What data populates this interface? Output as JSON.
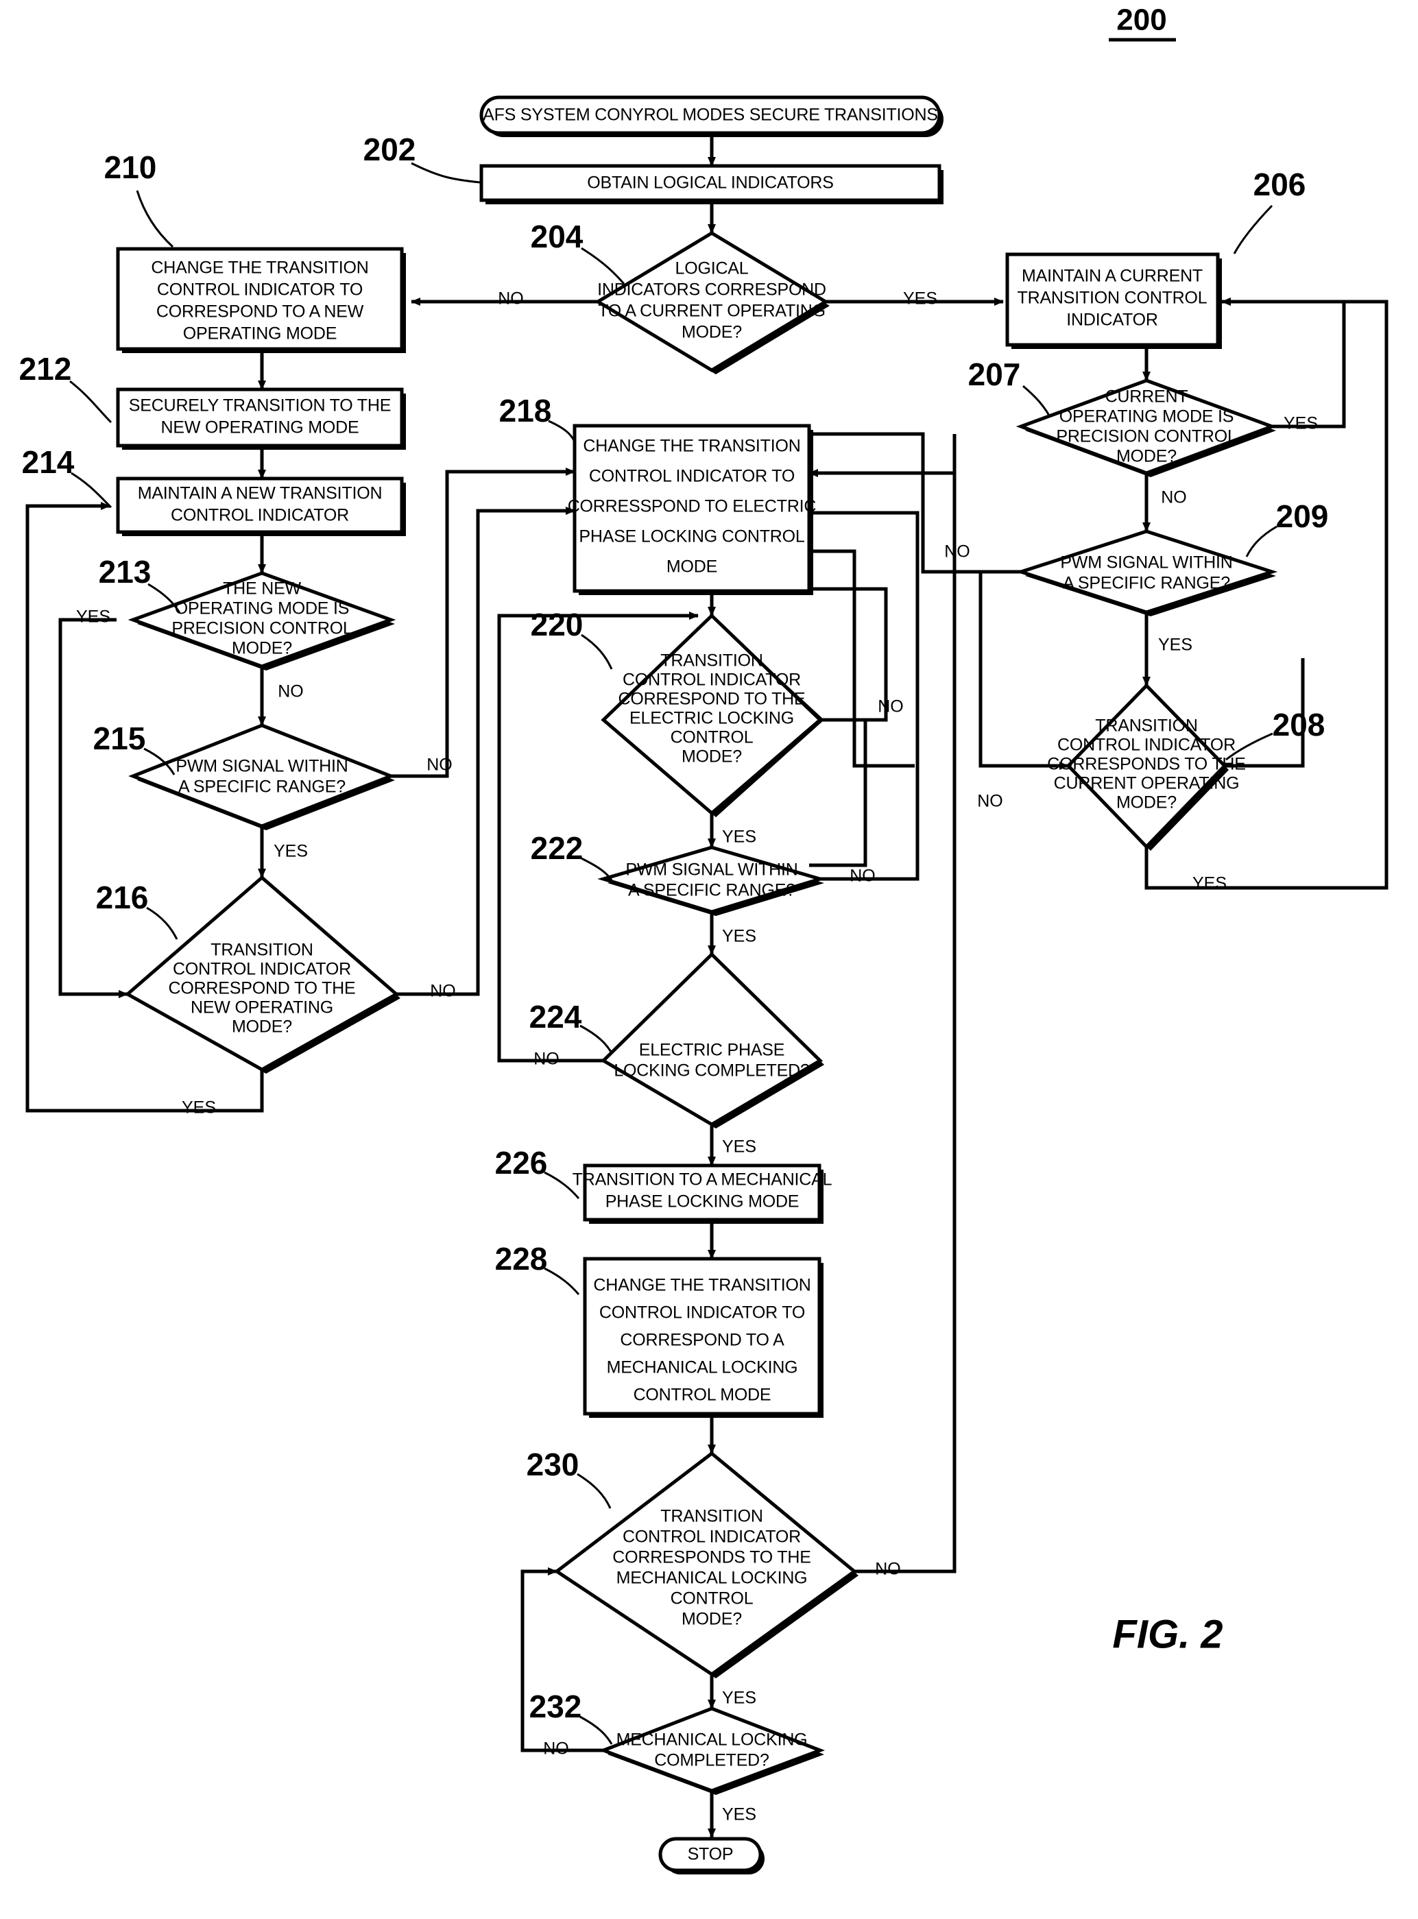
{
  "figure": {
    "number_label": "200",
    "caption": "FIG. 2"
  },
  "nodes": {
    "start": {
      "ref": "",
      "shape": "terminator",
      "text": "AFS SYSTEM CONYROL MODES SECURE TRANSITIONS"
    },
    "n202": {
      "ref": "202",
      "shape": "process",
      "text": "OBTAIN LOGICAL INDICATORS"
    },
    "n204": {
      "ref": "204",
      "shape": "decision",
      "lines": [
        "LOGICAL",
        "INDICATORS CORRESPOND",
        "TO A CURRENT OPERATING",
        "MODE?"
      ]
    },
    "n206": {
      "ref": "206",
      "shape": "process",
      "lines": [
        "MAINTAIN A CURRENT",
        "TRANSITION CONTROL",
        "INDICATOR"
      ]
    },
    "n207": {
      "ref": "207",
      "shape": "decision",
      "lines": [
        "CURRENT",
        "OPERATING MODE IS",
        "PRECISION CONTROL",
        "MODE?"
      ]
    },
    "n209": {
      "ref": "209",
      "shape": "decision",
      "lines": [
        "PWM SIGNAL WITHIN",
        "A SPECIFIC RANGE?"
      ]
    },
    "n208": {
      "ref": "208",
      "shape": "decision",
      "lines": [
        "TRANSITION",
        "CONTROL INDICATOR",
        "CORRESPONDS TO THE",
        "CURRENT OPERATING",
        "MODE?"
      ]
    },
    "n210": {
      "ref": "210",
      "shape": "process",
      "lines": [
        "CHANGE THE TRANSITION",
        "CONTROL INDICATOR TO",
        "CORRESPOND TO A NEW",
        "OPERATING MODE"
      ]
    },
    "n212": {
      "ref": "212",
      "shape": "process",
      "lines": [
        "SECURELY TRANSITION TO THE",
        "NEW OPERATING MODE"
      ]
    },
    "n214": {
      "ref": "214",
      "shape": "process",
      "lines": [
        "MAINTAIN A NEW TRANSITION",
        "CONTROL INDICATOR"
      ]
    },
    "n213": {
      "ref": "213",
      "shape": "decision",
      "lines": [
        "THE NEW",
        "OPERATING MODE IS",
        "PRECISION CONTROL",
        "MODE?"
      ]
    },
    "n215": {
      "ref": "215",
      "shape": "decision",
      "lines": [
        "PWM SIGNAL WITHIN",
        "A SPECIFIC RANGE?"
      ]
    },
    "n216": {
      "ref": "216",
      "shape": "decision",
      "lines": [
        "TRANSITION",
        "CONTROL INDICATOR",
        "CORRESPOND TO THE",
        "NEW OPERATING",
        "MODE?"
      ]
    },
    "n218": {
      "ref": "218",
      "shape": "process",
      "lines": [
        "CHANGE THE TRANSITION",
        "CONTROL INDICATOR TO",
        "CORRESSPOND TO ELECTRIC",
        "PHASE LOCKING CONTROL",
        "MODE"
      ]
    },
    "n220": {
      "ref": "220",
      "shape": "decision",
      "lines": [
        "TRANSITION",
        "CONTROL INDICATOR",
        "CORRESPOND TO THE",
        "ELECTRIC LOCKING",
        "CONTROL",
        "MODE?"
      ]
    },
    "n222": {
      "ref": "222",
      "shape": "decision",
      "lines": [
        "PWM SIGNAL WITHIN",
        "A SPECIFIC RANGE?"
      ]
    },
    "n224": {
      "ref": "224",
      "shape": "decision",
      "lines": [
        "ELECTRIC PHASE",
        "LOCKING COMPLETED?"
      ]
    },
    "n226": {
      "ref": "226",
      "shape": "process",
      "lines": [
        "TRANSITION TO A MECHANICAL",
        "PHASE LOCKING MODE"
      ]
    },
    "n228": {
      "ref": "228",
      "shape": "process",
      "lines": [
        "CHANGE THE TRANSITION",
        "CONTROL INDICATOR TO",
        "CORRESPOND TO A",
        "MECHANICAL LOCKING",
        "CONTROL MODE"
      ]
    },
    "n230": {
      "ref": "230",
      "shape": "decision",
      "lines": [
        "TRANSITION",
        "CONTROL INDICATOR",
        "CORRESPONDS TO THE",
        "MECHANICAL LOCKING",
        "CONTROL",
        "MODE?"
      ]
    },
    "n232": {
      "ref": "232",
      "shape": "decision",
      "lines": [
        "MECHANICAL LOCKING",
        "COMPLETED?"
      ]
    },
    "stop": {
      "ref": "",
      "shape": "terminator",
      "text": "STOP"
    }
  },
  "edge_labels": {
    "e204_no": "NO",
    "e204_yes": "YES",
    "e207_yes": "YES",
    "e207_no": "NO",
    "e209_no": "NO",
    "e209_yes": "YES",
    "e208_no": "NO",
    "e208_yes": "YES",
    "e213_yes": "YES",
    "e213_no": "NO",
    "e215_no": "NO",
    "e215_yes": "YES",
    "e216_no": "NO",
    "e216_yes": "YES",
    "e220_no": "NO",
    "e220_yes": "YES",
    "e222_no": "NO",
    "e222_yes": "YES",
    "e224_no": "NO",
    "e224_yes": "YES",
    "e230_no": "NO",
    "e230_yes": "YES",
    "e232_no": "NO",
    "e232_yes": "YES"
  },
  "colors": {
    "line": "#000000",
    "fill": "#ffffff",
    "text": "#000000"
  }
}
